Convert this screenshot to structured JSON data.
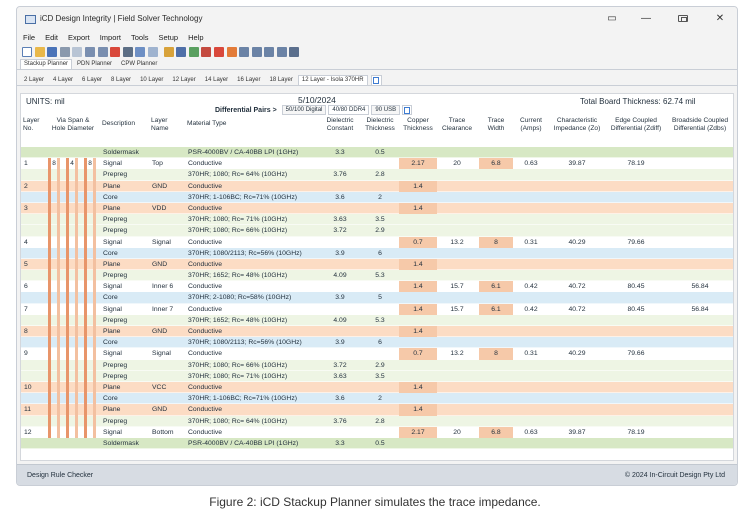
{
  "window": {
    "title": "iCD Design Integrity | Field Solver Technology"
  },
  "menu": [
    "File",
    "Edit",
    "Export",
    "Import",
    "Tools",
    "Setup",
    "Help"
  ],
  "planner_tabs": [
    {
      "label": "Stackup Planner",
      "active": true
    },
    {
      "label": "PDN Planner",
      "active": false
    },
    {
      "label": "CPW Planner",
      "active": false
    }
  ],
  "layer_tabs": [
    {
      "label": "2 Layer",
      "active": false
    },
    {
      "label": "4 Layer",
      "active": false
    },
    {
      "label": "6 Layer",
      "active": false
    },
    {
      "label": "8 Layer",
      "active": false
    },
    {
      "label": "10 Layer",
      "active": false
    },
    {
      "label": "12 Layer",
      "active": false
    },
    {
      "label": "14 Layer",
      "active": false
    },
    {
      "label": "16 Layer",
      "active": false
    },
    {
      "label": "18 Layer",
      "active": false
    },
    {
      "label": "12 Layer - Isola 370HR",
      "active": true
    }
  ],
  "sheet": {
    "units": "UNITS: mil",
    "date": "5/10/2024",
    "total_thickness": "Total Board Thickness: 62.74 mil",
    "diff_pairs_label": "Differential Pairs >",
    "diff_tabs": [
      {
        "label": "50/100 Digital",
        "active": false
      },
      {
        "label": "40/80 DDR4",
        "active": true
      },
      {
        "label": "90 USB",
        "active": false
      }
    ]
  },
  "columns": {
    "layer_no": "Layer\nNo.",
    "via_span": "Via Span &\nHole Diameter",
    "description": "Description",
    "layer_name": "Layer\nName",
    "material": "Material Type",
    "dk": "Dielectric\nConstant",
    "dthick": "Dielectric\nThickness",
    "cthick": "Copper\nThickness",
    "clearance": "Trace\nClearance",
    "width": "Trace\nWidth",
    "current": "Current\n(Amps)",
    "zo": "Characteristic\nImpedance (Zo)",
    "zdiff": "Edge Coupled\nDifferential (Zdiff)",
    "zdbs": "Broadside Coupled\nDifferential (Zdbs)"
  },
  "via_labels": [
    "8",
    "4",
    "8"
  ],
  "rows": [
    {
      "t": "mask",
      "no": "",
      "desc": "Soldermask",
      "name": "",
      "mat": "PSR-4000BV / CA-40BB LPI (1GHz)",
      "dk": "3.3",
      "dth": "0.5",
      "cu": "",
      "clr": "",
      "wid": "",
      "cur": "",
      "zo": "",
      "zd": "",
      "zb": ""
    },
    {
      "t": "sig",
      "no": "1",
      "desc": "Signal",
      "name": "Top",
      "mat": "Conductive",
      "dk": "",
      "dth": "",
      "cu": "2.17",
      "clr": "20",
      "wid": "6.8",
      "cur": "0.63",
      "zo": "39.87",
      "zd": "78.19",
      "zb": ""
    },
    {
      "t": "pre",
      "no": "",
      "desc": "Prepreg",
      "name": "",
      "mat": "370HR; 1080; Rc= 64% (10GHz)",
      "dk": "3.76",
      "dth": "2.8",
      "cu": "",
      "clr": "",
      "wid": "",
      "cur": "",
      "zo": "",
      "zd": "",
      "zb": ""
    },
    {
      "t": "pln",
      "no": "2",
      "desc": "Plane",
      "name": "GND",
      "mat": "Conductive",
      "dk": "",
      "dth": "",
      "cu": "1.4",
      "clr": "",
      "wid": "",
      "cur": "",
      "zo": "",
      "zd": "",
      "zb": ""
    },
    {
      "t": "core",
      "no": "",
      "desc": "Core",
      "name": "",
      "mat": "370HR; 1-106BC; Rc=71% (10GHz)",
      "dk": "3.6",
      "dth": "2",
      "cu": "",
      "clr": "",
      "wid": "",
      "cur": "",
      "zo": "",
      "zd": "",
      "zb": ""
    },
    {
      "t": "pln",
      "no": "3",
      "desc": "Plane",
      "name": "VDD",
      "mat": "Conductive",
      "dk": "",
      "dth": "",
      "cu": "1.4",
      "clr": "",
      "wid": "",
      "cur": "",
      "zo": "",
      "zd": "",
      "zb": ""
    },
    {
      "t": "pre",
      "no": "",
      "desc": "Prepreg",
      "name": "",
      "mat": "370HR; 1080; Rc= 71% (10GHz)",
      "dk": "3.63",
      "dth": "3.5",
      "cu": "",
      "clr": "",
      "wid": "",
      "cur": "",
      "zo": "",
      "zd": "",
      "zb": ""
    },
    {
      "t": "pre",
      "no": "",
      "desc": "Prepreg",
      "name": "",
      "mat": "370HR; 1080; Rc= 66% (10GHz)",
      "dk": "3.72",
      "dth": "2.9",
      "cu": "",
      "clr": "",
      "wid": "",
      "cur": "",
      "zo": "",
      "zd": "",
      "zb": ""
    },
    {
      "t": "sig",
      "no": "4",
      "desc": "Signal",
      "name": "Signal",
      "mat": "Conductive",
      "dk": "",
      "dth": "",
      "cu": "0.7",
      "clr": "13.2",
      "wid": "8",
      "cur": "0.31",
      "zo": "40.29",
      "zd": "79.66",
      "zb": ""
    },
    {
      "t": "core",
      "no": "",
      "desc": "Core",
      "name": "",
      "mat": "370HR; 1080/2113; Rc=56% (10GHz)",
      "dk": "3.9",
      "dth": "6",
      "cu": "",
      "clr": "",
      "wid": "",
      "cur": "",
      "zo": "",
      "zd": "",
      "zb": ""
    },
    {
      "t": "pln",
      "no": "5",
      "desc": "Plane",
      "name": "GND",
      "mat": "Conductive",
      "dk": "",
      "dth": "",
      "cu": "1.4",
      "clr": "",
      "wid": "",
      "cur": "",
      "zo": "",
      "zd": "",
      "zb": ""
    },
    {
      "t": "pre",
      "no": "",
      "desc": "Prepreg",
      "name": "",
      "mat": "370HR; 1652; Rc= 48% (10GHz)",
      "dk": "4.09",
      "dth": "5.3",
      "cu": "",
      "clr": "",
      "wid": "",
      "cur": "",
      "zo": "",
      "zd": "",
      "zb": ""
    },
    {
      "t": "sig",
      "no": "6",
      "desc": "Signal",
      "name": "Inner 6",
      "mat": "Conductive",
      "dk": "",
      "dth": "",
      "cu": "1.4",
      "clr": "15.7",
      "wid": "6.1",
      "cur": "0.42",
      "zo": "40.72",
      "zd": "80.45",
      "zb": "56.84"
    },
    {
      "t": "core",
      "no": "",
      "desc": "Core",
      "name": "",
      "mat": "370HR; 2-1080; Rc=58% (10GHz)",
      "dk": "3.9",
      "dth": "5",
      "cu": "",
      "clr": "",
      "wid": "",
      "cur": "",
      "zo": "",
      "zd": "",
      "zb": ""
    },
    {
      "t": "sig",
      "no": "7",
      "desc": "Signal",
      "name": "Inner 7",
      "mat": "Conductive",
      "dk": "",
      "dth": "",
      "cu": "1.4",
      "clr": "15.7",
      "wid": "6.1",
      "cur": "0.42",
      "zo": "40.72",
      "zd": "80.45",
      "zb": "56.84"
    },
    {
      "t": "pre",
      "no": "",
      "desc": "Prepreg",
      "name": "",
      "mat": "370HR; 1652; Rc= 48% (10GHz)",
      "dk": "4.09",
      "dth": "5.3",
      "cu": "",
      "clr": "",
      "wid": "",
      "cur": "",
      "zo": "",
      "zd": "",
      "zb": ""
    },
    {
      "t": "pln",
      "no": "8",
      "desc": "Plane",
      "name": "GND",
      "mat": "Conductive",
      "dk": "",
      "dth": "",
      "cu": "1.4",
      "clr": "",
      "wid": "",
      "cur": "",
      "zo": "",
      "zd": "",
      "zb": ""
    },
    {
      "t": "core",
      "no": "",
      "desc": "Core",
      "name": "",
      "mat": "370HR; 1080/2113; Rc=56% (10GHz)",
      "dk": "3.9",
      "dth": "6",
      "cu": "",
      "clr": "",
      "wid": "",
      "cur": "",
      "zo": "",
      "zd": "",
      "zb": ""
    },
    {
      "t": "sig",
      "no": "9",
      "desc": "Signal",
      "name": "Signal",
      "mat": "Conductive",
      "dk": "",
      "dth": "",
      "cu": "0.7",
      "clr": "13.2",
      "wid": "8",
      "cur": "0.31",
      "zo": "40.29",
      "zd": "79.66",
      "zb": ""
    },
    {
      "t": "pre",
      "no": "",
      "desc": "Prepreg",
      "name": "",
      "mat": "370HR; 1080; Rc= 66% (10GHz)",
      "dk": "3.72",
      "dth": "2.9",
      "cu": "",
      "clr": "",
      "wid": "",
      "cur": "",
      "zo": "",
      "zd": "",
      "zb": ""
    },
    {
      "t": "pre",
      "no": "",
      "desc": "Prepreg",
      "name": "",
      "mat": "370HR; 1080; Rc= 71% (10GHz)",
      "dk": "3.63",
      "dth": "3.5",
      "cu": "",
      "clr": "",
      "wid": "",
      "cur": "",
      "zo": "",
      "zd": "",
      "zb": ""
    },
    {
      "t": "pln",
      "no": "10",
      "desc": "Plane",
      "name": "VCC",
      "mat": "Conductive",
      "dk": "",
      "dth": "",
      "cu": "1.4",
      "clr": "",
      "wid": "",
      "cur": "",
      "zo": "",
      "zd": "",
      "zb": ""
    },
    {
      "t": "core",
      "no": "",
      "desc": "Core",
      "name": "",
      "mat": "370HR; 1-106BC; Rc=71% (10GHz)",
      "dk": "3.6",
      "dth": "2",
      "cu": "",
      "clr": "",
      "wid": "",
      "cur": "",
      "zo": "",
      "zd": "",
      "zb": ""
    },
    {
      "t": "pln",
      "no": "11",
      "desc": "Plane",
      "name": "GND",
      "mat": "Conductive",
      "dk": "",
      "dth": "",
      "cu": "1.4",
      "clr": "",
      "wid": "",
      "cur": "",
      "zo": "",
      "zd": "",
      "zb": ""
    },
    {
      "t": "pre",
      "no": "",
      "desc": "Prepreg",
      "name": "",
      "mat": "370HR; 1080; Rc= 64% (10GHz)",
      "dk": "3.76",
      "dth": "2.8",
      "cu": "",
      "clr": "",
      "wid": "",
      "cur": "",
      "zo": "",
      "zd": "",
      "zb": ""
    },
    {
      "t": "sig",
      "no": "12",
      "desc": "Signal",
      "name": "Bottom",
      "mat": "Conductive",
      "dk": "",
      "dth": "",
      "cu": "2.17",
      "clr": "20",
      "wid": "6.8",
      "cur": "0.63",
      "zo": "39.87",
      "zd": "78.19",
      "zb": ""
    },
    {
      "t": "mask",
      "no": "",
      "desc": "Soldermask",
      "name": "",
      "mat": "PSR-4000BV / CA-40BB LPI (1GHz)",
      "dk": "3.3",
      "dth": "0.5",
      "cu": "",
      "clr": "",
      "wid": "",
      "cur": "",
      "zo": "",
      "zd": "",
      "zb": ""
    }
  ],
  "row_colors": {
    "mask": "#d7e8c4",
    "sig": "#ffffff",
    "pre": "#eef5e4",
    "pln": "#fcdcc4",
    "core": "#d9ebf6"
  },
  "status": {
    "left": "Design Rule Checker",
    "right": "© 2024 In-Circuit Design Pty Ltd"
  },
  "caption": "Figure 2: iCD Stackup Planner simulates the trace impedance."
}
